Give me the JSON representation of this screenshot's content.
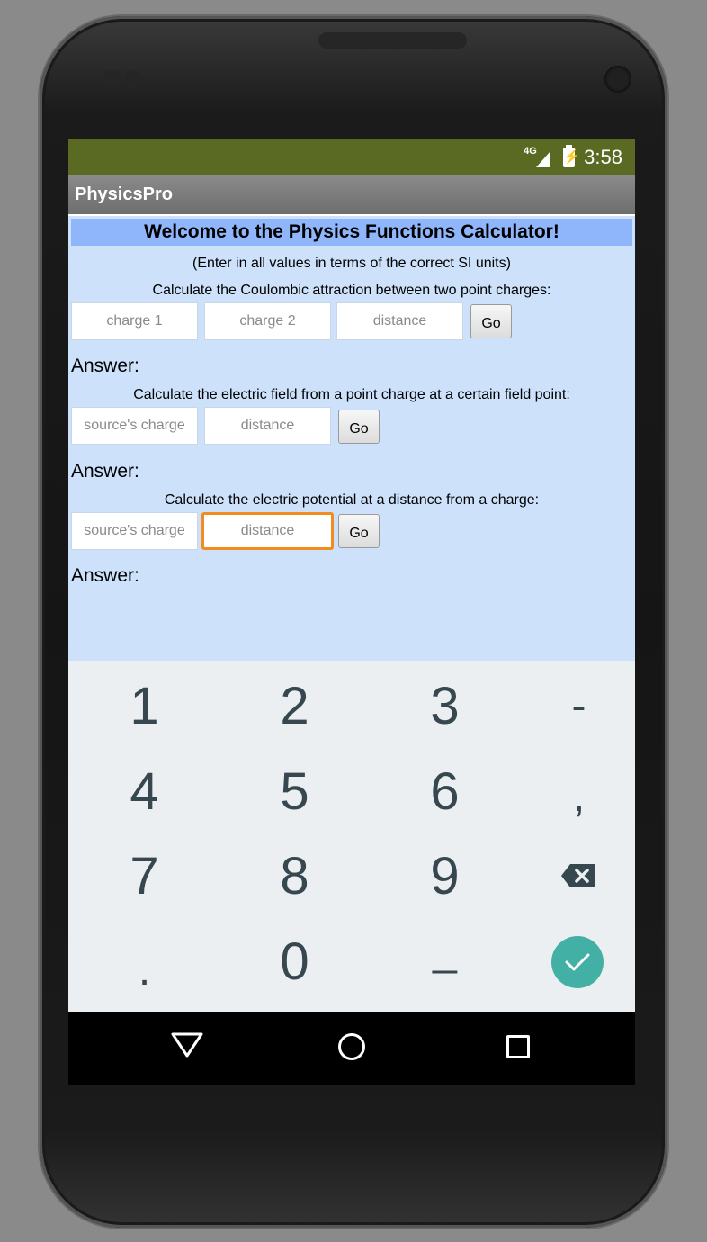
{
  "status_bar": {
    "network": "4G",
    "time": "3:58",
    "icons": [
      "signal-icon",
      "battery-charging-icon"
    ]
  },
  "app_bar": {
    "title": "PhysicsPro"
  },
  "main": {
    "welcome": "Welcome to the Physics Functions Calculator!",
    "instructions": "(Enter in all values in terms of the correct SI units)",
    "coulomb": {
      "prompt": "Calculate the Coulombic attraction between two point charges:",
      "charge1_placeholder": "charge 1",
      "charge2_placeholder": "charge 2",
      "distance_placeholder": "distance",
      "go_label": "Go",
      "answer_label": "Answer:"
    },
    "field": {
      "prompt": "Calculate the electric field from a point charge at a certain field point:",
      "source_placeholder": "source's charge",
      "distance_placeholder": "distance",
      "go_label": "Go",
      "answer_label": "Answer:"
    },
    "potential": {
      "prompt": "Calculate the electric potential at a distance  from a charge:",
      "source_placeholder": "source's charge",
      "distance_placeholder": "distance",
      "go_label": "Go",
      "answer_label": "Answer:"
    }
  },
  "keyboard": {
    "keys": [
      "1",
      "2",
      "3",
      "-",
      "4",
      "5",
      "6",
      ",",
      "7",
      "8",
      "9",
      ".",
      "0",
      "_"
    ],
    "special": [
      "backspace-icon",
      "checkmark-icon"
    ],
    "accent": "#26a69a"
  },
  "nav_bar": {
    "icons": [
      "back-icon",
      "home-icon",
      "recents-icon"
    ]
  },
  "colors": {
    "status_bar": "#5a6a22",
    "content_bg": "#cde1fb",
    "welcome_bg": "#8fb6fb",
    "focus_border": "#f28c1e"
  }
}
